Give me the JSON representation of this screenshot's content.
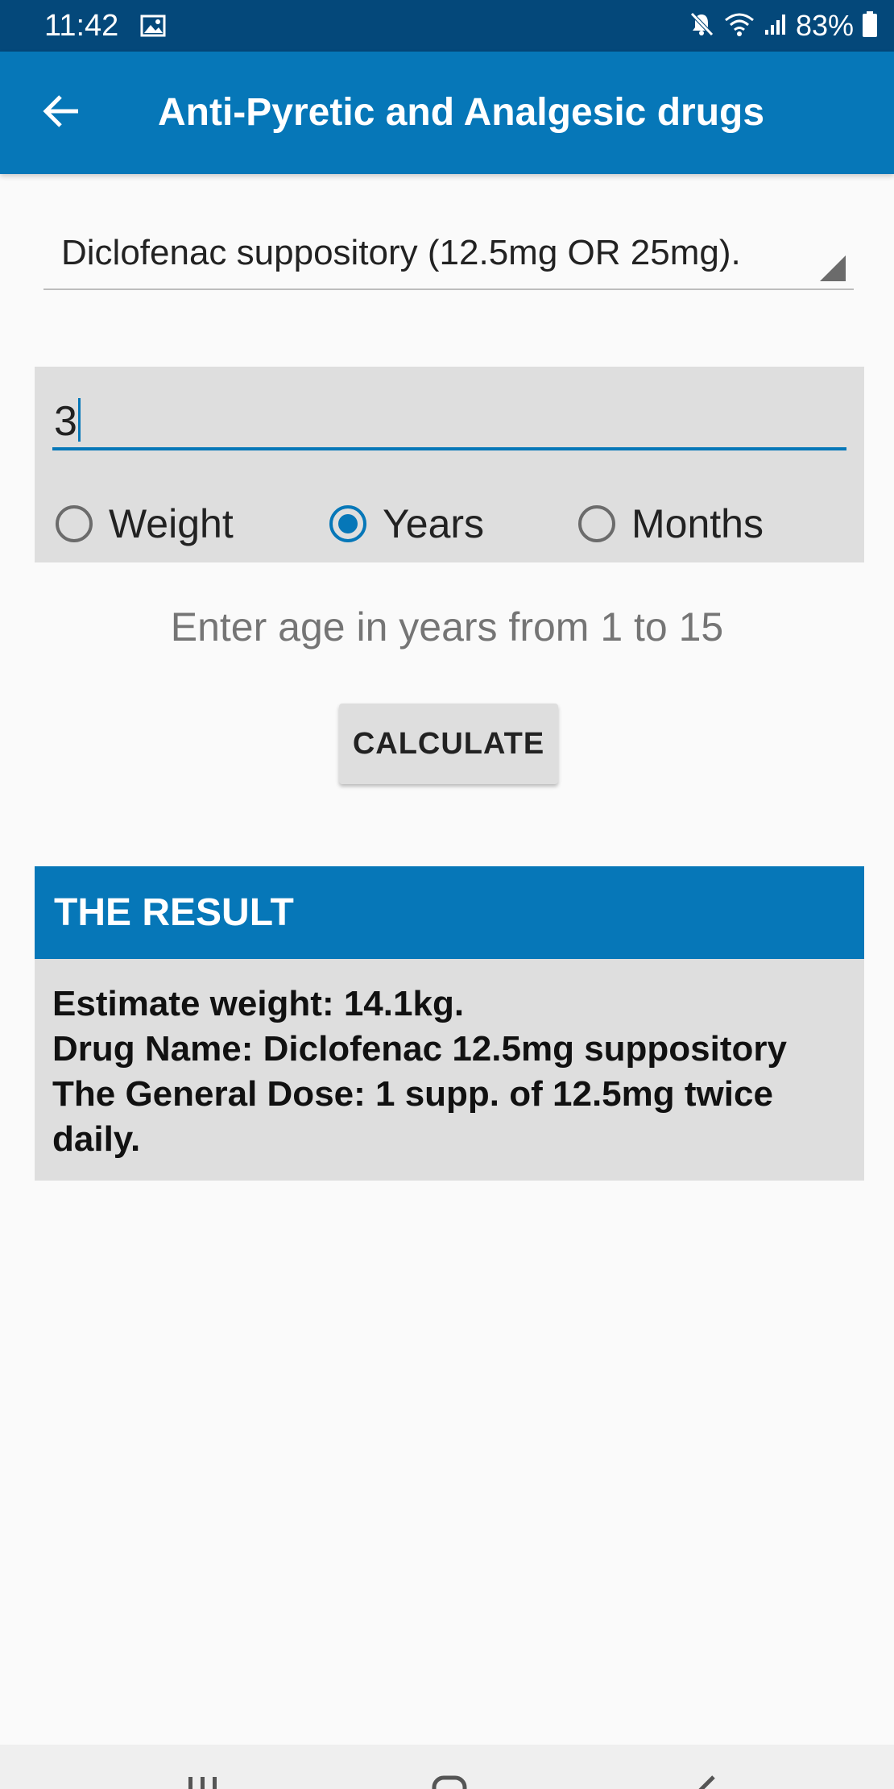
{
  "status_bar": {
    "time": "11:42",
    "battery_percent": "83%",
    "icons": [
      "gallery-icon",
      "mute-icon",
      "wifi-icon",
      "signal-icon",
      "battery-icon"
    ]
  },
  "app_bar": {
    "title": "Anti-Pyretic and Analgesic drugs",
    "back_icon": "arrow-left-icon"
  },
  "drug_selector": {
    "selected": "Diclofenac suppository (12.5mg OR 25mg)."
  },
  "age_input": {
    "value": "3"
  },
  "input_mode": {
    "options": [
      {
        "label": "Weight",
        "checked": false
      },
      {
        "label": "Years",
        "checked": true
      },
      {
        "label": "Months",
        "checked": false
      }
    ]
  },
  "hint": "Enter age in years from 1 to 15",
  "calculate_label": "CALCULATE",
  "result": {
    "title": "THE RESULT",
    "lines": [
      "Estimate weight: 14.1kg.",
      "Drug Name: Diclofenac 12.5mg suppository",
      "The General Dose: 1 supp. of 12.5mg twice daily."
    ]
  },
  "colors": {
    "status_bar": "#04487a",
    "primary": "#0677b8",
    "card": "#dedede",
    "background": "#fafafa"
  }
}
